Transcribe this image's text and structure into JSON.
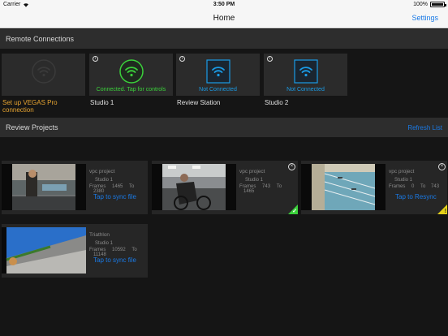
{
  "status_bar": {
    "carrier": "Carrier",
    "time": "3:50 PM",
    "battery": "100%",
    "battery_level": 1.0
  },
  "nav": {
    "title": "Home",
    "settings": "Settings"
  },
  "remote": {
    "title": "Remote Connections",
    "setup_label": "Set up VEGAS Pro connection",
    "tiles": [
      {
        "name": "Studio 1",
        "status": "Connected. Tap for controls",
        "status_color": "#3bd13b"
      },
      {
        "name": "Review Station",
        "status": "Not Connected",
        "status_color": "#1a9be6"
      },
      {
        "name": "Studio 2",
        "status": "Not Connected",
        "status_color": "#1a9be6"
      }
    ]
  },
  "review": {
    "title": "Review Projects",
    "refresh": "Refresh List",
    "cards": [
      {
        "project": "vpc project",
        "studio": "Studio 1",
        "frames_label": "Frames",
        "from": "1465",
        "to_label": "To",
        "to": "2380",
        "action": "Tap to sync file"
      },
      {
        "project": "vpc project",
        "studio": "Studio 1",
        "frames_label": "Frames",
        "from": "743",
        "to_label": "To",
        "to": "1465",
        "action": "",
        "badge": "synced",
        "badge_color": "#3bd13b"
      },
      {
        "project": "vpc project",
        "studio": "Studio 1",
        "frames_label": "Frames",
        "from": "0",
        "to_label": "To",
        "to": "743",
        "action": "Tap to Resync",
        "badge": "warning",
        "badge_color": "#e6d21a"
      },
      {
        "project": "Triathlon",
        "studio": "Studio 1",
        "frames_label": "Frames",
        "from": "10592",
        "to_label": "To",
        "to": "11148",
        "action": "Tap to sync file"
      }
    ]
  },
  "colors": {
    "accent": "#1a7ae6",
    "orange": "#e8a531"
  }
}
